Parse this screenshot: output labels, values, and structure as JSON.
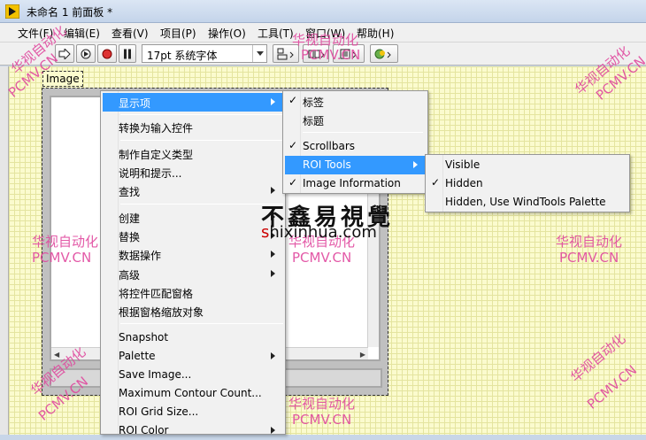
{
  "window": {
    "title": "未命名 1 前面板 *"
  },
  "menubar": [
    "文件(F)",
    "编辑(E)",
    "查看(V)",
    "项目(P)",
    "操作(O)",
    "工具(T)",
    "窗口(W)",
    "帮助(H)"
  ],
  "toolbar": {
    "font": "17pt 系统字体"
  },
  "image_control": {
    "label": "Image"
  },
  "context_menu": {
    "items": [
      {
        "label": "显示项",
        "submenu": true,
        "highlighted": true
      },
      {
        "label": "转换为输入控件"
      },
      {
        "label": "制作自定义类型"
      },
      {
        "label": "说明和提示..."
      },
      {
        "label": "查找",
        "submenu": true
      },
      {
        "label": "创建",
        "submenu": true
      },
      {
        "label": "替换",
        "submenu": true
      },
      {
        "label": "数据操作",
        "submenu": true
      },
      {
        "label": "高级",
        "submenu": true
      },
      {
        "label": "将控件匹配窗格"
      },
      {
        "label": "根据窗格缩放对象"
      },
      {
        "label": "Snapshot"
      },
      {
        "label": "Palette",
        "submenu": true
      },
      {
        "label": "Save Image..."
      },
      {
        "label": "Maximum Contour Count..."
      },
      {
        "label": "ROI Grid Size..."
      },
      {
        "label": "ROI Color",
        "submenu": true
      }
    ]
  },
  "visible_items_menu": {
    "items": [
      {
        "label": "标签",
        "checked": true
      },
      {
        "label": "标题",
        "checked": false
      },
      {
        "label": "Scrollbars",
        "checked": true
      },
      {
        "label": "ROI Tools",
        "checked": false,
        "submenu": true,
        "highlighted": true
      },
      {
        "label": "Image Information",
        "checked": true
      }
    ]
  },
  "roi_tools_menu": {
    "items": [
      {
        "label": "Visible",
        "checked": false
      },
      {
        "label": "Hidden",
        "checked": true
      },
      {
        "label": "Hidden, Use WindTools Palette",
        "checked": false
      }
    ]
  },
  "watermarks": {
    "cn": "华视自动化",
    "en": "PCMV.CN",
    "site_logo": "不鑫易視覺",
    "site_url_s": "s",
    "site_url_rest": "hixinhua.com"
  },
  "check_mark": "✓",
  "colors": {
    "highlight": "#3399ff",
    "panel_grid": "#fbfbce",
    "watermark": "#e0489e"
  }
}
